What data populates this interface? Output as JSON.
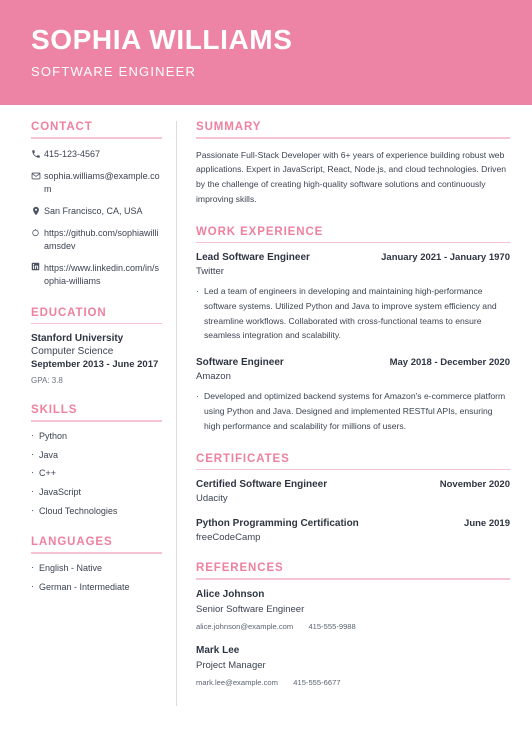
{
  "theme": {
    "banner_color": "#ed84a5",
    "heading_color": "#ee819f",
    "rule_color": "#f6c3d3",
    "text_color": "#3b4452"
  },
  "header": {
    "name": "SOPHIA WILLIAMS",
    "title": "SOFTWARE ENGINEER"
  },
  "contact": {
    "heading": "CONTACT",
    "items": [
      {
        "icon": "phone-icon",
        "value": "415-123-4567"
      },
      {
        "icon": "envelope-icon",
        "value": "sophia.williams@example.com"
      },
      {
        "icon": "location-pin-icon",
        "value": "San Francisco, CA, USA"
      },
      {
        "icon": "github-icon",
        "value": "https://github.com/sophiawilliamsdev"
      },
      {
        "icon": "linkedin-icon",
        "value": "https://www.linkedin.com/in/sophia-williams"
      }
    ]
  },
  "education": {
    "heading": "EDUCATION",
    "school": "Stanford University",
    "degree": "Computer Science",
    "dates": "September 2013 - June 2017",
    "gpa": "GPA: 3.8"
  },
  "skills": {
    "heading": "SKILLS",
    "items": [
      "Python",
      "Java",
      "C++",
      "JavaScript",
      "Cloud Technologies"
    ]
  },
  "languages": {
    "heading": "LANGUAGES",
    "items": [
      "English - Native",
      "German - Intermediate"
    ]
  },
  "summary": {
    "heading": "SUMMARY",
    "text": "Passionate Full-Stack Developer with 6+ years of experience building robust web applications. Expert in JavaScript, React, Node.js, and cloud technologies. Driven by the challenge of creating high-quality software solutions and continuously improving skills."
  },
  "work_experience": {
    "heading": "WORK EXPERIENCE",
    "entries": [
      {
        "role": "Lead Software Engineer",
        "date": "January 2021 - January 1970",
        "org": "Twitter",
        "points": [
          "Led a team of engineers in developing and maintaining high-performance software systems. Utilized Python and Java to improve system efficiency and streamline workflows. Collaborated with cross-functional teams to ensure seamless integration and scalability."
        ]
      },
      {
        "role": "Software Engineer",
        "date": "May 2018 - December 2020",
        "org": "Amazon",
        "points": [
          "Developed and optimized backend systems for Amazon's e-commerce platform using Python and Java. Designed and implemented RESTful APIs, ensuring high performance and scalability for millions of users."
        ]
      }
    ]
  },
  "certificates": {
    "heading": "CERTIFICATES",
    "entries": [
      {
        "role": "Certified Software Engineer",
        "date": "November 2020",
        "org": "Udacity"
      },
      {
        "role": "Python Programming Certification",
        "date": "June 2019",
        "org": "freeCodeCamp"
      }
    ]
  },
  "references": {
    "heading": "REFERENCES",
    "entries": [
      {
        "name": "Alice Johnson",
        "role": "Senior Software Engineer",
        "email": "alice.johnson@example.com",
        "phone": "415-555-9988"
      },
      {
        "name": "Mark Lee",
        "role": "Project Manager",
        "email": "mark.lee@example.com",
        "phone": "415-555-6677"
      }
    ]
  }
}
